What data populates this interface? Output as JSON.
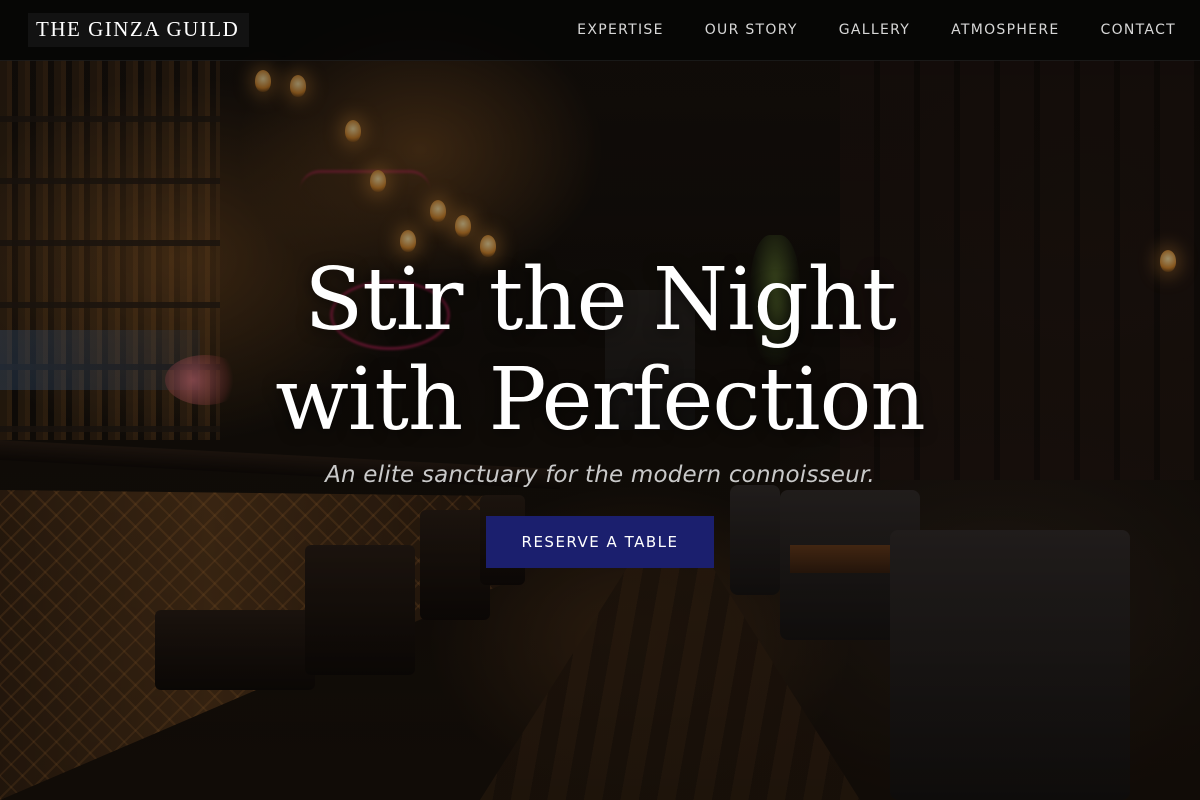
{
  "brand": {
    "name": "THE GINZA GUILD"
  },
  "nav": {
    "links": [
      "EXPERTISE",
      "OUR STORY",
      "GALLERY",
      "ATMOSPHERE",
      "CONTACT"
    ]
  },
  "hero": {
    "title_line1": "Stir the Night",
    "title_line2": "with Perfection",
    "subtitle": "An elite sanctuary for the modern connoisseur.",
    "cta_label": "RESERVE A TABLE"
  },
  "colors": {
    "nav_background": "#050505",
    "cta_background": "#1b1f6e",
    "text_primary": "#ffffff",
    "text_muted": "#c9c9c9"
  }
}
